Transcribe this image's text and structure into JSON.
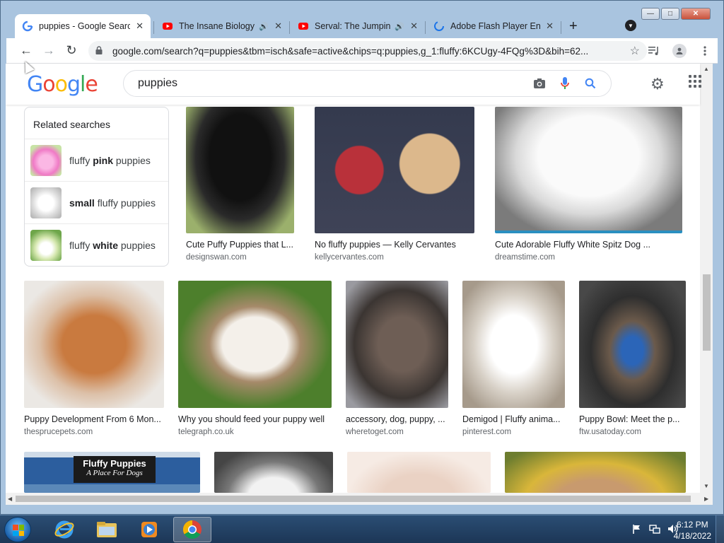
{
  "window": {
    "controls": {
      "minimize": "—",
      "maximize": "□",
      "close": "✕"
    }
  },
  "tabs": [
    {
      "title": "puppies - Google Search",
      "favicon": "google-g-icon",
      "audio": false,
      "active": true
    },
    {
      "title": "The Insane Biology of: The Owl",
      "favicon": "youtube-icon",
      "audio": true,
      "active": false
    },
    {
      "title": "Serval: The Jumping Cat",
      "favicon": "youtube-icon",
      "audio": true,
      "active": false
    },
    {
      "title": "Adobe Flash Player End of Life",
      "favicon": "loading-spinner-icon",
      "audio": false,
      "active": false
    }
  ],
  "tab_close_glyph": "✕",
  "tab_audio_glyph": "🔊",
  "newtab_glyph": "+",
  "toolbar": {
    "back": "←",
    "forward": "→",
    "reload": "↻",
    "url": "google.com/search?q=puppies&tbm=isch&safe=active&chips=q:puppies,g_1:fluffy:6KCUgy-4FQg%3D&bih=62...",
    "star": "☆"
  },
  "google": {
    "logo_letters": [
      {
        "ch": "G",
        "color": "#4285f4"
      },
      {
        "ch": "o",
        "color": "#ea4335"
      },
      {
        "ch": "o",
        "color": "#fbbc05"
      },
      {
        "ch": "g",
        "color": "#4285f4"
      },
      {
        "ch": "l",
        "color": "#34a853"
      },
      {
        "ch": "e",
        "color": "#ea4335"
      }
    ],
    "query": "puppies"
  },
  "related": {
    "heading": "Related searches",
    "items": [
      {
        "pre": "fluffy ",
        "bold": "pink",
        "post": " puppies",
        "thumb": "#f07ac6"
      },
      {
        "pre": "",
        "bold": "small",
        "post": " fluffy puppies",
        "thumb": "#e8e8e8"
      },
      {
        "pre": "fluffy ",
        "bold": "white",
        "post": " puppies",
        "thumb": "#8cc063"
      }
    ]
  },
  "results": [
    {
      "caption": "Cute Puffy Puppies that L...",
      "source": "designswan.com",
      "bg": "#2a2a2a",
      "accent": "#8aa860"
    },
    {
      "caption": "No fluffy puppies — Kelly Cervantes",
      "source": "kellycervantes.com",
      "bg": "#3a3f52",
      "accent": "#d8b48a"
    },
    {
      "caption": "Cute Adorable Fluffy White Spitz Dog ...",
      "source": "dreamstime.com",
      "bg": "#8b8b8b",
      "accent": "#f2f2f2"
    },
    {
      "caption": "Puppy Development From 6 Mon...",
      "source": "thesprucepets.com",
      "bg": "#e9e6e2",
      "accent": "#c5773d"
    },
    {
      "caption": "Why you should feed your puppy well",
      "source": "telegraph.co.uk",
      "bg": "#5f8f3a",
      "accent": "#f1ede8"
    },
    {
      "caption": "accessory, dog, puppy, ...",
      "source": "wheretoget.com",
      "bg": "#3b3532",
      "accent": "#7b6a60"
    },
    {
      "caption": "Demigod | Fluffy anima...",
      "source": "pinterest.com",
      "bg": "#b9ad9e",
      "accent": "#f5f3ee"
    },
    {
      "caption": "Puppy Bowl: Meet the p...",
      "source": "ftw.usatoday.com",
      "bg": "#444",
      "accent": "#2b65b8"
    },
    {
      "banner_title": "Fluffy Puppies",
      "banner_sub": "A Place For Dogs",
      "bg": "#2c5e9e",
      "accent": "#1b1b1b"
    },
    {
      "bg": "#444",
      "accent": "#eee"
    },
    {
      "bg": "#f4e6dc",
      "accent": "#e8d0c0"
    },
    {
      "bg": "#d8b430",
      "accent": "#c8a07a"
    }
  ],
  "taskbar": {
    "time": "6:12 PM",
    "date": "4/18/2022"
  }
}
